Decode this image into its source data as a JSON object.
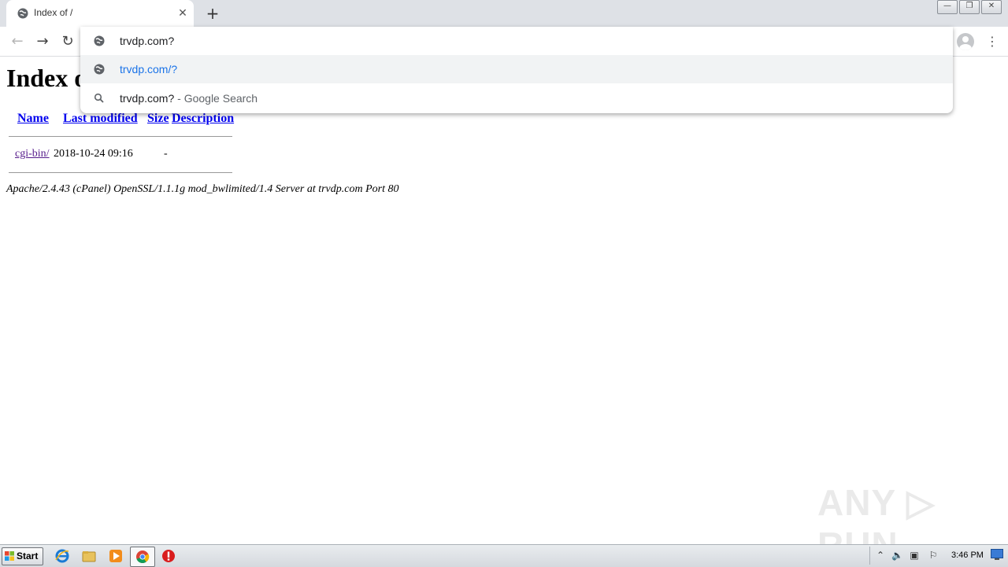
{
  "browser": {
    "tab": {
      "title": "Index of /",
      "close_icon": "close-icon"
    },
    "new_tab_label": "+",
    "window_controls": {
      "minimize": "—",
      "restore": "❐",
      "close": "✕"
    },
    "toolbar": {
      "back": "←",
      "forward": "→",
      "reload": "↻",
      "menu": "⋮"
    },
    "omnibox": {
      "input_value": "trvdp.com?",
      "suggestions": [
        {
          "text": "trvdp.com/?",
          "icon": "globe-icon"
        },
        {
          "text": "trvdp.com?",
          "hint": " - Google Search",
          "icon": "search-icon"
        }
      ]
    }
  },
  "page": {
    "heading": "Index of /",
    "columns": {
      "name": "Name",
      "last_modified": "Last modified",
      "size": "Size",
      "description": "Description"
    },
    "rows": [
      {
        "name": "cgi-bin/",
        "date": "2018-10-24 09:16",
        "size": "-"
      }
    ],
    "address": "Apache/2.4.43 (cPanel) OpenSSL/1.1.1g mod_bwlimited/1.4 Server at trvdp.com Port 80"
  },
  "watermark": "ANY ▷ RUN",
  "taskbar": {
    "start_label": "Start",
    "clock": "3:46 PM",
    "tray_icons": [
      "chevron-up-icon",
      "speaker-icon",
      "network-icon",
      "flag-icon"
    ],
    "pinned": [
      "ie-icon",
      "explorer-icon",
      "media-player-icon",
      "chrome-icon",
      "stop-icon"
    ]
  }
}
